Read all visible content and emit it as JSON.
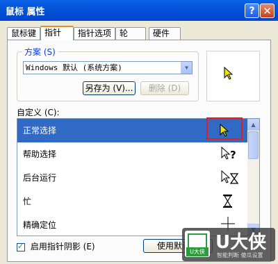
{
  "window": {
    "title": "鼠标 属性",
    "help_glyph": "?",
    "close_glyph": "✕"
  },
  "tabs": [
    {
      "label": "鼠标键"
    },
    {
      "label": "指针"
    },
    {
      "label": "指针选项"
    },
    {
      "label": "轮"
    },
    {
      "label": "硬件"
    }
  ],
  "scheme": {
    "label": "方案 (S)",
    "selected": "Windows 默认 (系统方案)",
    "save_as_label": "另存为 (V)...",
    "delete_label": "删除 (D)"
  },
  "customize": {
    "label": "自定义 (C):",
    "rows": [
      {
        "label": "正常选择",
        "icon": "arrow-cursor-icon",
        "selected": true
      },
      {
        "label": "帮助选择",
        "icon": "help-cursor-icon"
      },
      {
        "label": "后台运行",
        "icon": "working-cursor-icon"
      },
      {
        "label": "忙",
        "icon": "hourglass-icon"
      },
      {
        "label": "精确定位",
        "icon": "crosshair-icon"
      }
    ]
  },
  "shadow_checkbox": {
    "label": "启用指针阴影 (E)",
    "checked": true
  },
  "use_default_button": {
    "label": "使用默认值"
  },
  "watermark": {
    "brand": "U大侠",
    "mark_text": "U大侠",
    "sub": "智能判断 傻瓜设置"
  },
  "colors": {
    "title_bar": "#0353d9",
    "selection": "#316ac5",
    "highlight_box": "#e02020"
  }
}
